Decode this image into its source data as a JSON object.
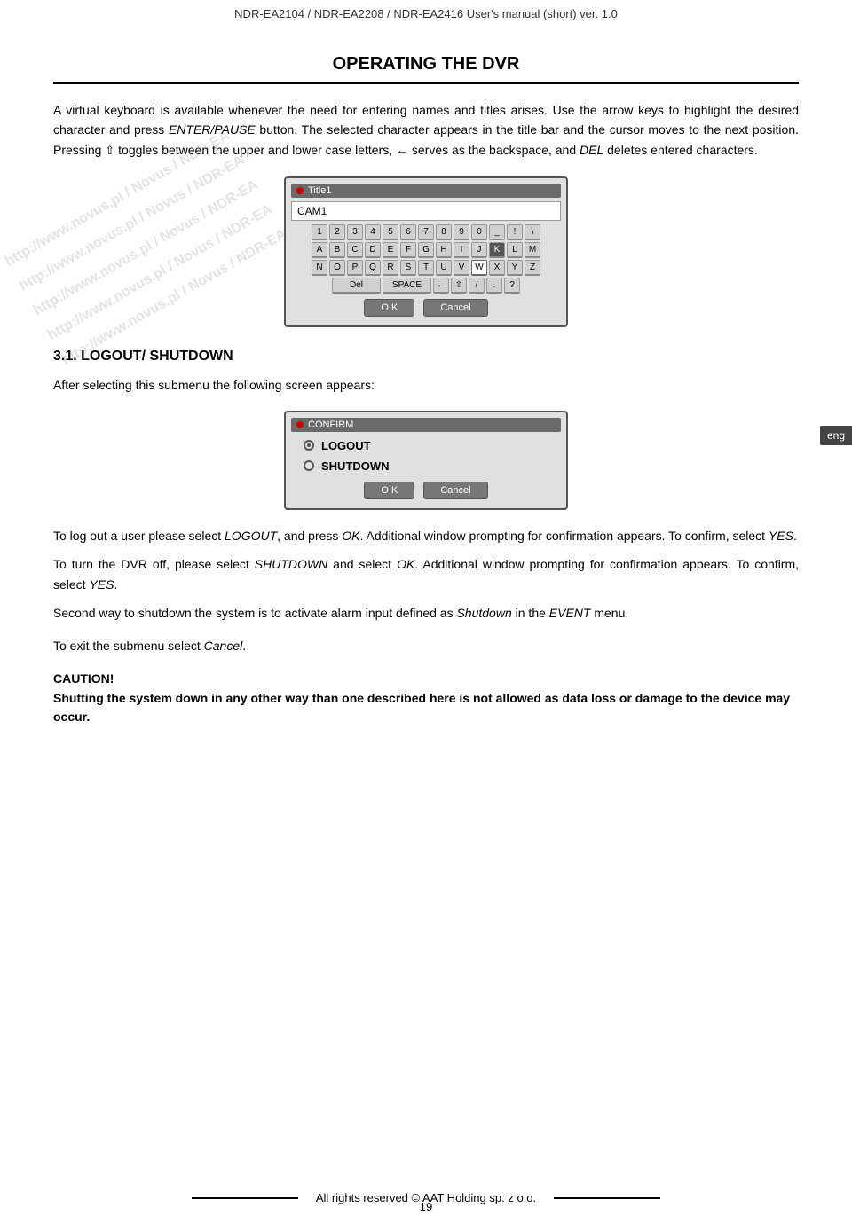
{
  "header": {
    "title": "NDR-EA2104 / NDR-EA2208 / NDR-EA2416 User's manual (short) ver. 1.0"
  },
  "section": {
    "title": "OPERATING THE DVR"
  },
  "intro_para1": "A virtual keyboard is available whenever the need for entering names and titles arises. Use the arrow keys to highlight the desired character and press ",
  "intro_para1_italic": "ENTER/PAUSE",
  "intro_para1_end": " button. The selected character appears in the title bar and the cursor moves to the next position. Pressing ",
  "intro_para1_end2": " toggles between the upper and lower case letters, ",
  "intro_para1_end3": " serves as the backspace, and ",
  "intro_para1_del": "DEL",
  "intro_para1_final": " deletes entered characters.",
  "keyboard": {
    "title_label": "Title1",
    "input_value": "CAM1",
    "rows": [
      [
        "1",
        "2",
        "3",
        "4",
        "5",
        "6",
        "7",
        "8",
        "9",
        "0",
        "_",
        "!",
        "\\"
      ],
      [
        "A",
        "B",
        "C",
        "D",
        "E",
        "F",
        "G",
        "H",
        "I",
        "J",
        "K",
        "L",
        "M"
      ],
      [
        "N",
        "O",
        "P",
        "Q",
        "R",
        "S",
        "T",
        "U",
        "V",
        "W",
        "X",
        "Y",
        "Z"
      ],
      [
        "Del",
        "SPACE",
        "←",
        "⇧",
        "/",
        ".",
        "?"
      ]
    ],
    "highlighted_key": "W",
    "buttons": [
      "O K",
      "Cancel"
    ]
  },
  "subsection": {
    "number": "3.1.",
    "title": "LOGOUT/ SHUTDOWN"
  },
  "after_select_text": "After selecting this submenu the following screen appears:",
  "confirm_dialog": {
    "title_label": "CONFIRM",
    "options": [
      "LOGOUT",
      "SHUTDOWN"
    ],
    "selected": "LOGOUT",
    "buttons": [
      "O K",
      "Cancel"
    ]
  },
  "para_logout1_start": "To log out a user please select ",
  "para_logout1_italic": "LOGOUT",
  "para_logout1_mid": ", and press ",
  "para_logout1_ok": "OK",
  "para_logout1_end": ". Additional window prompting for confirmation appears. To confirm, select ",
  "para_logout1_yes": "YES",
  "para_logout1_final": ".",
  "para_shutdown1_start": "To turn the DVR off, please select ",
  "para_shutdown1_italic": "SHUTDOWN",
  "para_shutdown1_mid": " and select ",
  "para_shutdown1_ok": "OK",
  "para_shutdown1_end": ". Additional window prompting for confirmation appears. To confirm, select ",
  "para_shutdown1_yes": "YES",
  "para_shutdown1_final": ".",
  "para_second_way": "Second way to shutdown the system is to activate alarm input defined as ",
  "para_second_italic1": "Shutdown",
  "para_second_mid": " in the ",
  "para_second_italic2": "EVENT",
  "para_second_end": " menu.",
  "para_exit": "To exit the submenu select ",
  "para_exit_italic": "Cancel",
  "para_exit_final": ".",
  "caution": {
    "title": "CAUTION!",
    "text": "Shutting the system down in any other way than one described here is not allowed as data loss or damage to the device may occur."
  },
  "footer": {
    "text": "All rights reserved © AAT Holding sp. z o.o."
  },
  "page_number": "19",
  "eng_badge": "eng",
  "watermark_lines": [
    "http://www.novus.pl / Novus / NDR-EA",
    "http://www.novus.pl / Novus / NDR-EA"
  ]
}
